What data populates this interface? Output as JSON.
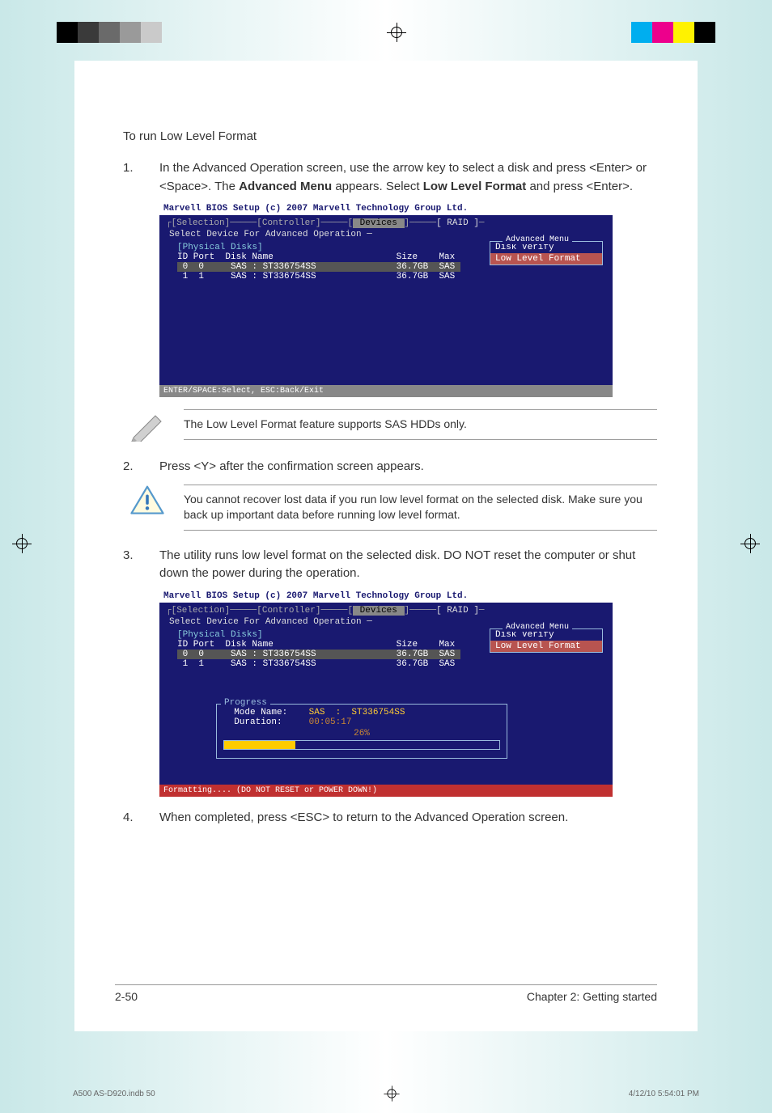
{
  "print": {
    "swatches_left": [
      "#000000",
      "#3a3a3a",
      "#6a6a6a",
      "#9a9a9a",
      "#cacaca"
    ],
    "swatches_right": [
      "#00aeef",
      "#ed008c",
      "#fff200",
      "#000000"
    ],
    "file_label": "A500 AS-D920.indb   50",
    "timestamp": "4/12/10   5:54:01 PM"
  },
  "heading": "To run Low Level Format",
  "steps": {
    "s1": {
      "num": "1.",
      "text_a": "In the Advanced Operation screen, use the arrow key to select a disk and press <Enter> or <Space>. The ",
      "bold_a": "Advanced Menu",
      "text_b": " appears. Select ",
      "bold_b": "Low Level Format",
      "text_c": " and press <Enter>."
    },
    "s2": {
      "num": "2.",
      "text": "Press <Y> after the confirmation screen appears."
    },
    "s3": {
      "num": "3.",
      "text": "The utility runs low level format on the selected disk. DO NOT reset the computer or shut down the power during the operation."
    },
    "s4": {
      "num": "4.",
      "text": "When completed, press <ESC> to return to the Advanced Operation screen."
    }
  },
  "bios": {
    "title": "Marvell BIOS Setup (c) 2007 Marvell Technology Group Ltd.",
    "tab_selection": "[Selection]",
    "tab_controller": "[Controller]",
    "tab_devices": " Devices ",
    "tab_raid": "[  RAID  ]",
    "subtitle": "Select Device For Advanced Operation",
    "section": "[Physical Disks]",
    "header": "ID Port  Disk Name                       Size    Max",
    "row0": " 0  0     SAS : ST336754SS               36.7GB  SAS ",
    "row1": " 1  1     SAS : ST336754SS               36.7GB  SAS ",
    "menu_title": "Advanced Menu",
    "menu_item0": "Disk Verify",
    "menu_item1": "Low Level Format",
    "footer1": "ENTER/SPACE:Select, ESC:Back/Exit",
    "footer2": "Formatting.... (DO NOT RESET or POWER DOWN!)",
    "progress": {
      "title": "Progress",
      "mode_label": "Mode Name:",
      "mode_value": "SAS  :  ST336754SS",
      "duration_label": "Duration:",
      "duration_value": "00:05:17",
      "pct": "26%"
    }
  },
  "notes": {
    "n1": "The Low Level Format feature supports SAS HDDs only.",
    "n2": "You cannot recover lost data if you run low level format on the selected disk. Make sure you back up important data before running low level format."
  },
  "footer": {
    "page": "2-50",
    "chapter": "Chapter 2: Getting started"
  }
}
